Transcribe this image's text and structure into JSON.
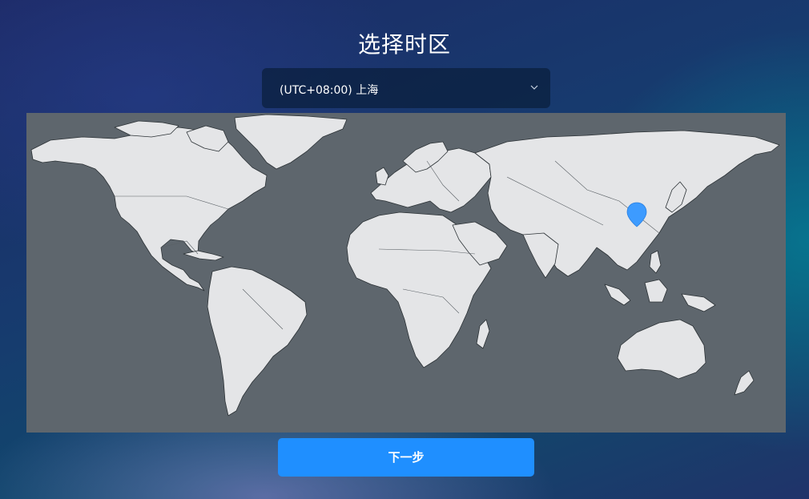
{
  "page": {
    "title": "选择时区"
  },
  "timezone_select": {
    "selected": "(UTC+08:00) 上海",
    "icon": "chevron-down-icon"
  },
  "map": {
    "marker_icon": "location-pin-icon",
    "marker_color": "#3d9bff",
    "selected_city": "上海"
  },
  "next_button": {
    "label": "下一步",
    "color": "#1f8fff"
  }
}
